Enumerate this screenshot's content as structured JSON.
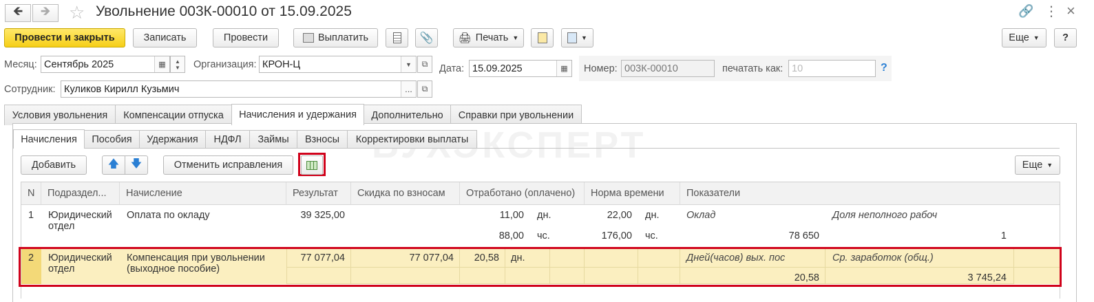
{
  "window": {
    "title": "Увольнение 003К-00010 от 15.09.2025"
  },
  "toolbar": {
    "post_close": "Провести и закрыть",
    "save": "Записать",
    "post": "Провести",
    "pay": "Выплатить",
    "print": "Печать",
    "more": "Еще",
    "help": "?"
  },
  "header": {
    "month_label": "Месяц:",
    "month_value": "Сентябрь 2025",
    "org_label": "Организация:",
    "org_value": "КРОН-Ц",
    "date_label": "Дата:",
    "date_value": "15.09.2025",
    "number_label": "Номер:",
    "number_value": "003К-00010",
    "print_as_label": "печатать как:",
    "print_as_placeholder": "10",
    "help": "?",
    "employee_label": "Сотрудник:",
    "employee_value": "Куликов Кирилл Кузьмич",
    "ellipsis": "..."
  },
  "tabs": [
    {
      "label": "Условия увольнения"
    },
    {
      "label": "Компенсации отпуска"
    },
    {
      "label": "Начисления и удержания"
    },
    {
      "label": "Дополнительно"
    },
    {
      "label": "Справки при увольнении"
    }
  ],
  "subtabs": [
    {
      "label": "Начисления"
    },
    {
      "label": "Пособия"
    },
    {
      "label": "Удержания"
    },
    {
      "label": "НДФЛ"
    },
    {
      "label": "Займы"
    },
    {
      "label": "Взносы"
    },
    {
      "label": "Корректировки выплаты"
    }
  ],
  "watermark": "БУХЭКСПЕРТ",
  "grid_toolbar": {
    "add": "Добавить",
    "cancel_fix": "Отменить исправления",
    "more": "Еще"
  },
  "grid": {
    "columns": [
      "N",
      "Подраздел...",
      "Начисление",
      "Результат",
      "Скидка по взносам",
      "Отработано (оплачено)",
      "Норма времени",
      "Показатели"
    ],
    "rows": [
      {
        "n": "1",
        "dept1": "Юридический",
        "dept2": "отдел",
        "accrual1": "Оплата по окладу",
        "accrual2": "",
        "result": "39 325,00",
        "discount": "",
        "worked1": "11,00",
        "worked1_unit": "дн.",
        "worked2": "88,00",
        "worked2_unit": "чс.",
        "norm1": "22,00",
        "norm1_unit": "дн.",
        "norm2": "176,00",
        "norm2_unit": "чс.",
        "ind1_name": "Оклад",
        "ind1_value": "78 650",
        "ind2_name": "Доля неполного рабоч",
        "ind2_value": "1"
      },
      {
        "n": "2",
        "dept1": "Юридический",
        "dept2": "отдел",
        "accrual1": "Компенсация при увольнении",
        "accrual2": "(выходное пособие)",
        "result": "77 077,04",
        "discount": "77 077,04",
        "worked1": "20,58",
        "worked1_unit": "дн.",
        "ind1_name": "Дней(часов) вых. пос",
        "ind1_value": "20,58",
        "ind2_name": "Ср. заработок (общ.)",
        "ind2_value": "3 745,24"
      }
    ]
  },
  "colors": {
    "primary_button": "#f6cf17",
    "selected_row": "#fbefc0",
    "highlight_border": "#d0021b",
    "arrow_blue": "#2a7fd4"
  }
}
